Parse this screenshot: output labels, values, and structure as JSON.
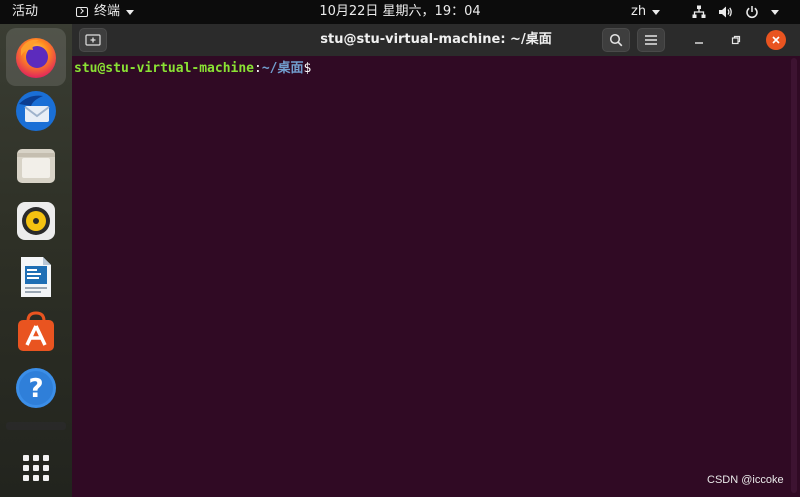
{
  "topbar": {
    "activities": "活动",
    "app_name": "终端",
    "clock": "10月22日 星期六，19：04",
    "lang": "zh"
  },
  "window": {
    "title": "stu@stu-virtual-machine: ~/桌面"
  },
  "terminal": {
    "user_host": "stu@stu-virtual-machine",
    "separator": ":",
    "path": "~/桌面",
    "symbol": "$"
  },
  "watermark": "CSDN @iccoke",
  "dock": {
    "apps": [
      "firefox-icon",
      "thunderbird-icon",
      "files-icon",
      "rhythmbox-icon",
      "libreoffice-writer-icon",
      "software-center-icon",
      "help-icon",
      "show-apps-icon"
    ]
  },
  "colors": {
    "terminal_bg": "#300a24",
    "prompt_user": "#8ae234",
    "prompt_path": "#729fcf",
    "close_button": "#e95420"
  }
}
